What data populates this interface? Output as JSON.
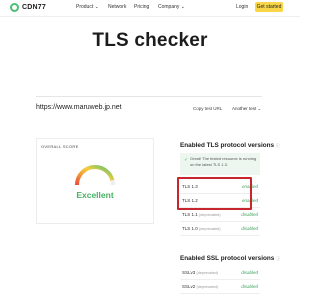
{
  "nav": {
    "logo": "CDN77",
    "items": [
      "Product",
      "Network",
      "Pricing",
      "Company"
    ],
    "login": "Login",
    "cta": "Get started"
  },
  "title": "TLS checker",
  "url_row": {
    "url": "https://www.maruweb.jp.net",
    "copy_label": "Copy test URL",
    "another_label": "Another test"
  },
  "score": {
    "label": "OVERALL SCORE",
    "value": "Excellent",
    "gauge_level": 0.92
  },
  "tls": {
    "title": "Enabled TLS protocol versions",
    "notice": "Great! The tested resource is running on the latest TLS 1.3.",
    "rows": [
      {
        "name": "TLS 1.3",
        "dep": "",
        "status": "enabled"
      },
      {
        "name": "TLS 1.2",
        "dep": "",
        "status": "enabled"
      },
      {
        "name": "TLS 1.1",
        "dep": "(deprecated)",
        "status": "disabled"
      },
      {
        "name": "TLS 1.0",
        "dep": "(deprecated)",
        "status": "disabled"
      }
    ]
  },
  "ssl": {
    "title": "Enabled SSL protocol versions",
    "rows": [
      {
        "name": "SSLv3",
        "dep": "(deprecated)",
        "status": "disabled"
      },
      {
        "name": "SSLv2",
        "dep": "(deprecated)",
        "status": "disabled"
      }
    ]
  },
  "colors": {
    "accent_green": "#4bbf73",
    "cta_yellow": "#f9d648",
    "highlight_red": "#c8262e"
  }
}
